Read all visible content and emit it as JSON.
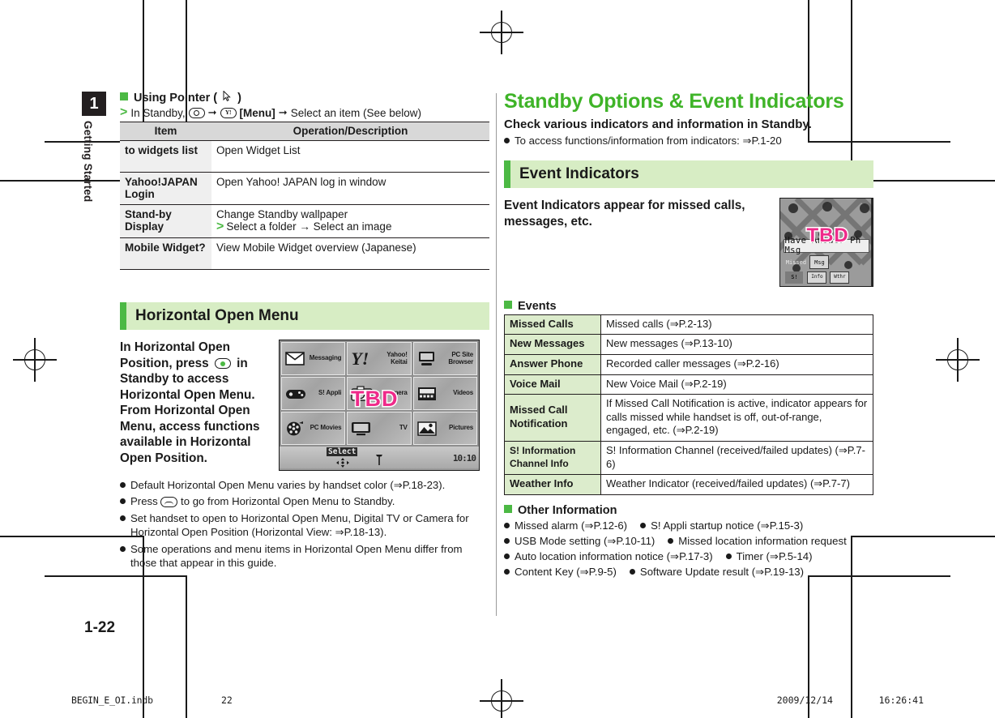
{
  "chapter": {
    "number": "1",
    "label": "Getting Started"
  },
  "folio": "1-22",
  "footer": {
    "file_name": "BEGIN_E_OI.indb",
    "file_page": "22",
    "date": "2009/12/14",
    "time": "16:26:41"
  },
  "colors": {
    "brand_green": "#3fb428",
    "accent_green": "#4cb944",
    "section_bg": "#d7edc4",
    "table_key_green": "#dceccc",
    "table_header_gray": "#d8d8d8",
    "table_key_gray": "#efefef",
    "tbd_pink": "#ef2a8a"
  },
  "left": {
    "pointer_heading": "Using Pointer (",
    "pointer_heading_close": ")",
    "steps": {
      "prefix": "In Standby,",
      "menu_label": "[Menu]",
      "suffix": "Select an item (See below)"
    },
    "pointer_table": {
      "headers": [
        "Item",
        "Operation/Description"
      ],
      "rows": [
        {
          "item": "to widgets list",
          "desc": "Open Widget List",
          "sub": ""
        },
        {
          "item": "Yahoo!JAPAN Login",
          "desc": "Open Yahoo! JAPAN log in window",
          "sub": ""
        },
        {
          "item": "Stand-by Display",
          "desc": "Change Standby wallpaper",
          "sub": "Select a folder → Select an image"
        },
        {
          "item": "Mobile Widget?",
          "desc": "View Mobile Widget overview  (Japanese)",
          "sub": ""
        }
      ]
    },
    "section_title": "Horizontal Open Menu",
    "intro_a": "In Horizontal Open Position, press",
    "intro_b": "in Standby to access Horizontal Open Menu. From Horizontal Open Menu, access functions available in Horizontal Open Position.",
    "bullets": [
      "Default Horizontal Open Menu varies by handset color (⇒P.18-23).",
      "Press   to go from Horizontal Open Menu to Standby.",
      "Set handset to open to Horizontal Open Menu, Digital TV or Camera for Horizontal Open Position (Horizontal View: ⇒P.18-13).",
      "Some operations and menu items in Horizontal Open Menu differ from those that appear in this guide."
    ],
    "menu_screenshot": {
      "tbd": "TBD",
      "select_label": "Select",
      "clock": "10:10",
      "tiles": [
        {
          "label": "Messaging",
          "icon": "envelope-icon"
        },
        {
          "label": "Yahoo! Keitai",
          "icon": "yahoo-icon"
        },
        {
          "label": "PC Site Browser",
          "icon": "monitor-icon"
        },
        {
          "label": "S! Appli",
          "icon": "gamepad-icon"
        },
        {
          "label": "Camera",
          "icon": "camera-icon"
        },
        {
          "label": "Videos",
          "icon": "film-icon"
        },
        {
          "label": "PC Movies",
          "icon": "reel-icon"
        },
        {
          "label": "TV",
          "icon": "tv-icon"
        },
        {
          "label": "Pictures",
          "icon": "picture-icon"
        }
      ]
    }
  },
  "right": {
    "title": "Standby Options & Event Indicators",
    "subtitle": "Check various indicators and information in Standby.",
    "intro_bullet": "To access functions/information from indicators: ⇒P.1-20",
    "section_title": "Event Indicators",
    "lead": "Event Indicators appear for missed calls, messages, etc.",
    "standby_screenshot": {
      "tbd": "TBD",
      "ticker": "Have Answer Ph Msg",
      "icons": [
        "Missed",
        "Msg",
        "S!",
        "Info",
        "Wthr"
      ]
    },
    "events_heading": "Events",
    "events": [
      {
        "key": "Missed Calls",
        "value": "Missed calls (⇒P.2-13)"
      },
      {
        "key": "New Messages",
        "value": "New messages (⇒P.13-10)"
      },
      {
        "key": "Answer Phone",
        "value": "Recorded caller messages (⇒P.2-16)"
      },
      {
        "key": "Voice Mail",
        "value": "New Voice Mail (⇒P.2-19)"
      },
      {
        "key": "Missed Call Notification",
        "value": "If Missed Call Notification is active, indicator appears for calls missed while handset is off, out-of-range, engaged, etc. (⇒P.2-19)"
      },
      {
        "key": "S! Information Channel Info",
        "value": "S! Information Channel (received/failed updates) (⇒P.7-6)"
      },
      {
        "key": "Weather Info",
        "value": "Weather Indicator (received/failed updates) (⇒P.7-7)"
      }
    ],
    "other_heading": "Other Information",
    "other_rows": [
      [
        "Missed alarm (⇒P.12-6)",
        "S! Appli startup notice (⇒P.15-3)"
      ],
      [
        "USB Mode setting (⇒P.10-11)",
        "Missed location information request"
      ],
      [
        "Auto location information notice (⇒P.17-3)",
        "Timer (⇒P.5-14)"
      ],
      [
        "Content Key (⇒P.9-5)",
        "Software Update result (⇒P.19-13)"
      ]
    ]
  }
}
